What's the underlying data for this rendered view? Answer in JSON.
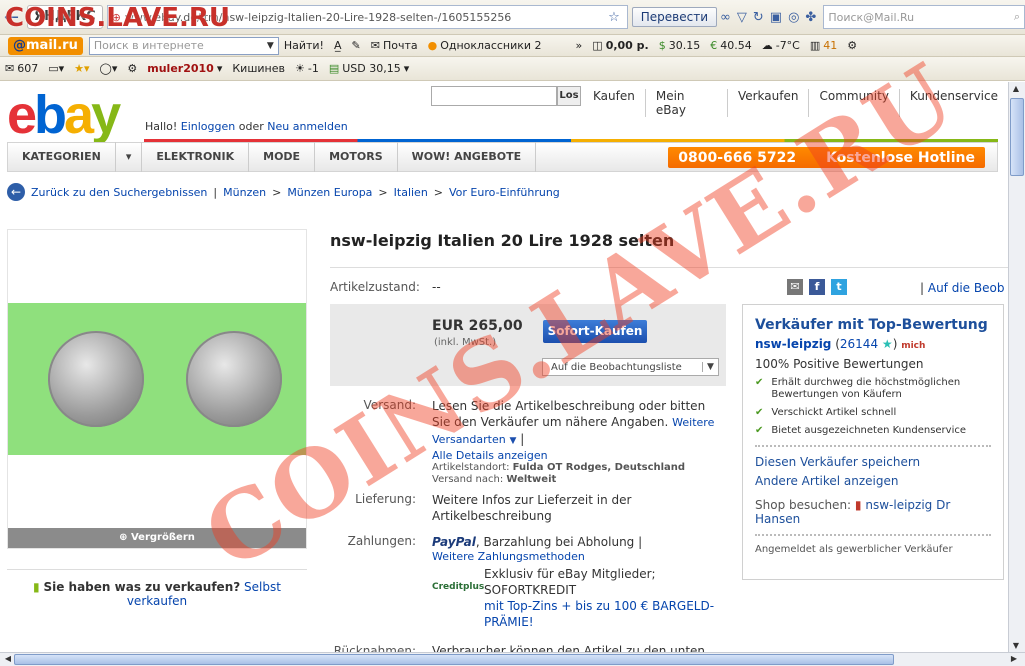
{
  "watermark": {
    "top_text": "COINS.LAVE.RU",
    "diagonal_text": "COINS.LAVE.RU"
  },
  "browser": {
    "back_label": "←",
    "yandex_badge": "ЯНДЕКС",
    "url": "www.ebay.de/itm/nsw-leipzig-Italien-20-Lire-1928-selten-/1605155256",
    "translate_button": "Перевести",
    "search_placeholder": "Поиск@Mail.Ru",
    "mailru_logo_at": "@",
    "mailru_logo_text": "mail.ru",
    "internet_search_placeholder": "Поиск в интернете",
    "find_button": "Найти!",
    "mail_label": "Почта",
    "ok_label": "Одноклассники 2",
    "money": "0,00 р.",
    "usd_rate": "30.15",
    "eur_rate": "40.54",
    "weather": "-7°C",
    "notif_count": "41",
    "mail_count": "607",
    "username": "muler2010",
    "city": "Кишинев",
    "city_temp": "-1",
    "usd_label": "USD 30,15"
  },
  "ebay": {
    "logo": {
      "e": "e",
      "b": "b",
      "a": "a",
      "y": "y"
    },
    "hello_text": "Hallo!",
    "login_link": "Einloggen",
    "or_text": "oder",
    "register_link": "Neu anmelden",
    "search_button": "Los",
    "topnav": [
      "Kaufen",
      "Mein eBay",
      "Verkaufen",
      "Community",
      "Kundenservice"
    ],
    "categories": [
      "KATEGORIEN",
      "ELEKTRONIK",
      "MODE",
      "MOTORS",
      "WOW! ANGEBOTE"
    ],
    "hotline_phone": "0800-666 5722",
    "hotline_label": "Kostenlose Hotline"
  },
  "breadcrumb": {
    "back": "Zurück zu den Suchergebnissen",
    "path": [
      "Münzen",
      "Münzen Europa",
      "Italien",
      "Vor Euro-Einführung"
    ],
    "sep": ">"
  },
  "item": {
    "title": "nsw-leipzig Italien 20 Lire 1928 selten",
    "zoom_label": "Vergrößern",
    "sell_question": "Sie haben was zu verkaufen?",
    "sell_link": "Selbst verkaufen",
    "condition_label": "Artikelzustand:",
    "condition_value": "--",
    "price": "EUR 265,00",
    "price_note": "(inkl. MwSt.)",
    "buy_button": "Sofort-Kaufen",
    "watch_button": "Auf die Beobachtungsliste",
    "watch_link": "Auf die Beob",
    "shipping_label": "Versand:",
    "shipping_text": "Lesen Sie die Artikelbeschreibung oder bitten Sie den Verkäufer um nähere Angaben.",
    "shipping_more": "Weitere Versandarten",
    "shipping_details": "Alle Details anzeigen",
    "location_label": "Artikelstandort:",
    "location_value": "Fulda OT Rodges, Deutschland",
    "ships_to_label": "Versand nach:",
    "ships_to_value": "Weltweit",
    "delivery_label": "Lieferung:",
    "delivery_text": "Weitere Infos zur Lieferzeit in der Artikelbeschreibung",
    "payment_label": "Zahlungen:",
    "paypal": "PayPal",
    "payment_text": ", Barzahlung bei Abholung |",
    "payment_more": "Weitere Zahlungsmethoden",
    "creditplus": "Creditplus",
    "creditplus_line1": "Exklusiv für eBay Mitglieder;",
    "creditplus_line2": "SOFORTKREDIT",
    "creditplus_line3": "mit Top-Zins + bis zu 100 € BARGELD-PRÄMIE!",
    "returns_label": "Rücknahmen:",
    "returns_text": "Verbraucher können den Artikel zu den unten"
  },
  "seller": {
    "heading": "Verkäufer mit Top-Bewertung",
    "name": "nsw-leipzig",
    "score": "26144",
    "me_badge": "mich",
    "positive": "100% Positive Bewertungen",
    "checks": [
      "Erhält durchweg die höchstmöglichen Bewertungen von Käufern",
      "Verschickt Artikel schnell",
      "Bietet ausgezeichneten Kundenservice"
    ],
    "save_seller": "Diesen Verkäufer speichern",
    "other_items": "Andere Artikel anzeigen",
    "shop_label": "Shop besuchen:",
    "shop_name": "nsw-leipzig Dr Hansen",
    "business_note": "Angemeldet als gewerblicher Verkäufer"
  }
}
